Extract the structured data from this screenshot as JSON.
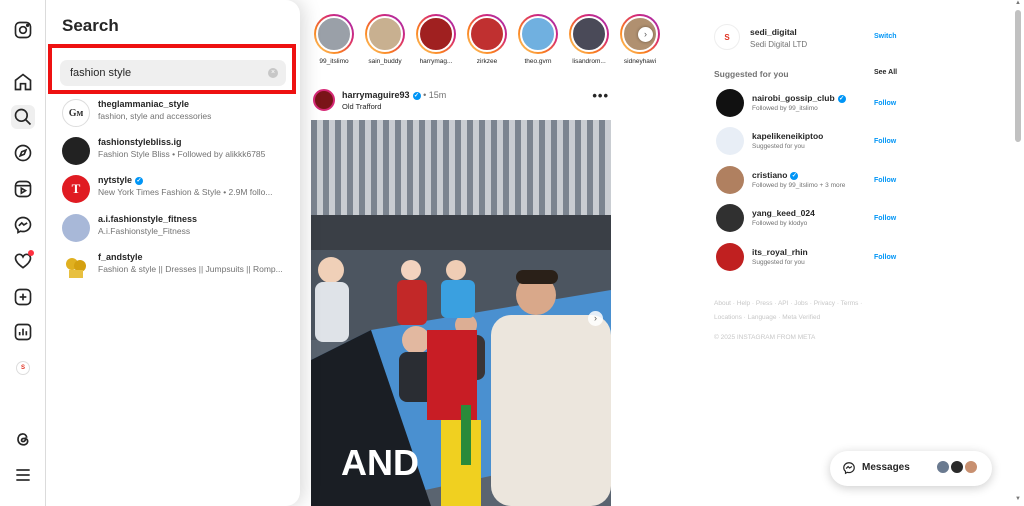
{
  "search": {
    "title": "Search",
    "query": "fashion style",
    "clear": "×",
    "results": [
      {
        "username": "theglammaniac_style",
        "subtitle": "fashion, style and accessories",
        "verified": false,
        "avatar_color": "#ffffff"
      },
      {
        "username": "fashionstylebliss.ig",
        "subtitle": "Fashion Style Bliss • Followed by alikkk6785",
        "verified": false,
        "avatar_color": "#222222"
      },
      {
        "username": "nytstyle",
        "subtitle": "New York Times Fashion & Style • 2.9M follo...",
        "verified": true,
        "avatar_color": "#e01b22"
      },
      {
        "username": "a.i.fashionstyle_fitness",
        "subtitle": "A.i.Fashionstyle_Fitness",
        "verified": false,
        "avatar_color": "#a8b8d8"
      },
      {
        "username": "f_andstyle",
        "subtitle": "Fashion & style || Dresses || Jumpsuits || Romp...",
        "verified": false,
        "avatar_color": "#e0b020"
      }
    ]
  },
  "stories": [
    {
      "name": "99_itslimo",
      "color": "#9aa0a8"
    },
    {
      "name": "sain_buddy",
      "color": "#c8b090"
    },
    {
      "name": "harrymag...",
      "color": "#a02020"
    },
    {
      "name": "zirkzee",
      "color": "#c03030"
    },
    {
      "name": "theo.gvrn",
      "color": "#70b0e0"
    },
    {
      "name": "lisandrom...",
      "color": "#4a4a58"
    },
    {
      "name": "sidneyhawi",
      "color": "#b09070"
    }
  ],
  "post": {
    "username": "harrymaguire93",
    "time": "• 15m",
    "location": "Old Trafford",
    "more": "•••",
    "verified": true
  },
  "account": {
    "username": "sedi_digital",
    "full_name": "Sedi Digital LTD",
    "switch_label": "Switch"
  },
  "suggestions": {
    "title": "Suggested for you",
    "see_all": "See All",
    "items": [
      {
        "username": "nairobi_gossip_club",
        "subtitle": "Followed by 99_itslimo",
        "verified": true,
        "action": "Follow",
        "color": "#111111"
      },
      {
        "username": "kapelikeneikiptoo",
        "subtitle": "Suggested for you",
        "verified": false,
        "action": "Follow",
        "color": "#e8eef6"
      },
      {
        "username": "cristiano",
        "subtitle": "Followed by 99_itslimo + 3 more",
        "verified": true,
        "action": "Follow",
        "color": "#b08060"
      },
      {
        "username": "yang_keed_024",
        "subtitle": "Followed by klodyo",
        "verified": false,
        "action": "Follow",
        "color": "#303030"
      },
      {
        "username": "its_royal_rhin",
        "subtitle": "Suggested for you",
        "verified": false,
        "action": "Follow",
        "color": "#c02020"
      }
    ]
  },
  "footer": {
    "links": "About · Help · Press · API · Jobs · Privacy · Terms · Locations · Language · Meta Verified",
    "copyright": "© 2025 INSTAGRAM FROM META"
  },
  "messages": {
    "label": "Messages"
  }
}
